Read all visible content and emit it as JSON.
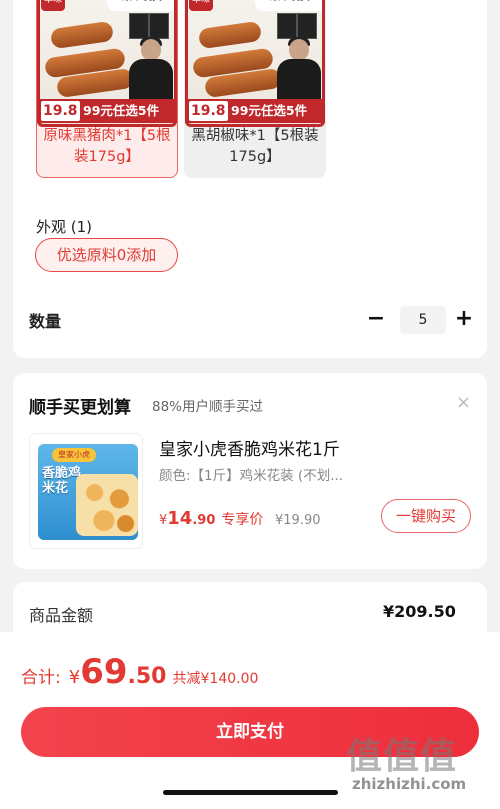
{
  "variants": [
    {
      "header": "顺丰发货",
      "logo": "本味",
      "price_box": "19.8",
      "price_text": "99元任选5件",
      "label": "原味黑猪肉*1【5根装175g】",
      "selected": true
    },
    {
      "header": "顺丰发货",
      "logo": "本味",
      "price_box": "19.8",
      "price_text": "99元任选5件",
      "label": "黑胡椒味*1【5根装175g】",
      "selected": false
    }
  ],
  "appearance": {
    "label": "外观 (1)",
    "chip": "优选原料0添加"
  },
  "quantity": {
    "label": "数量",
    "minus": "−",
    "value": "5",
    "plus": "+"
  },
  "recommend": {
    "title": "顺手买更划算",
    "subtitle": "88%用户顺手买过",
    "close": "×",
    "product": {
      "image_tag": "皇家小虎",
      "image_text": "香脆鸡米花",
      "name": "皇家小虎香脆鸡米花1斤",
      "spec": "颜色:【1斤】鸡米花装 (不划...",
      "price_currency": "¥",
      "price_int": "14",
      "price_dec": ".90",
      "price_label": "专享价",
      "original_price": "¥19.90",
      "buy_button": "一键购买"
    }
  },
  "price_summary": {
    "label": "商品金额",
    "value": "¥209.50"
  },
  "bottom": {
    "total_label": "合计:",
    "currency": "¥",
    "total_int": "69",
    "total_dec": ".50",
    "discount": "共减¥140.00",
    "pay_button": "立即支付"
  },
  "watermark": {
    "big": "值值值",
    "small": "zhizhizhi.com"
  },
  "colors": {
    "accent": "#e23a32",
    "pay_button": "#ee2e3b"
  }
}
